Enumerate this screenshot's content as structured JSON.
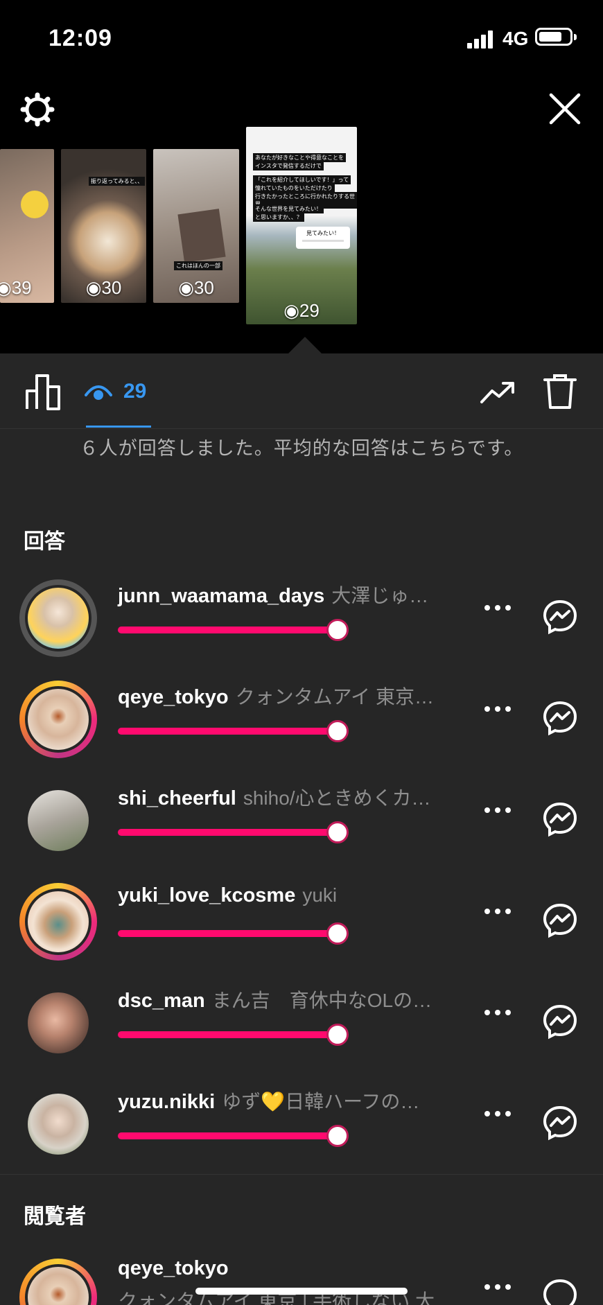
{
  "status": {
    "time": "12:09",
    "network": "4G"
  },
  "stories": [
    {
      "views": "39"
    },
    {
      "views": "30",
      "caption": "振り返ってみると、、"
    },
    {
      "views": "30",
      "caption": "これはほんの一部"
    },
    {
      "views": "29",
      "caption_lines": [
        "あなたが好きなことや得意なことを",
        "インスタで発信するだけで",
        "「これを紹介してほしいです！」って",
        "憧れていたものをいただけたり",
        "行きたかったところに行かれたりする世界",
        "そんな世界を見てみたい！",
        "と思いますか、、？"
      ],
      "sticker": "見てみたい！"
    }
  ],
  "toolbar": {
    "view_count": "29"
  },
  "summary": "６人が回答しました。平均的な回答はこちらです。",
  "responses_title": "回答",
  "responses": [
    {
      "username": "junn_waamama_days",
      "fullname": "大澤じゅ…",
      "value": 1.0
    },
    {
      "username": "qeye_tokyo",
      "fullname": "クォンタムアイ 東京…",
      "value": 1.0
    },
    {
      "username": "shi_cheerful",
      "fullname": "shiho/心ときめくカ…",
      "value": 1.0
    },
    {
      "username": "yuki_love_kcosme",
      "fullname": "yuki",
      "value": 1.0
    },
    {
      "username": "dsc_man",
      "fullname": "まん吉　育休中なOLの…",
      "value": 1.0
    },
    {
      "username": "yuzu.nikki",
      "fullname": "ゆず💛日韓ハーフの…",
      "value": 1.0
    }
  ],
  "viewers_title": "閲覧者",
  "viewers": [
    {
      "username": "qeye_tokyo",
      "fullname": "クォンタムアイ 東京 | 手術しない 大"
    }
  ],
  "colors": {
    "accent": "#3897f0",
    "slider": "#ff0a6e",
    "panel": "#262626"
  }
}
